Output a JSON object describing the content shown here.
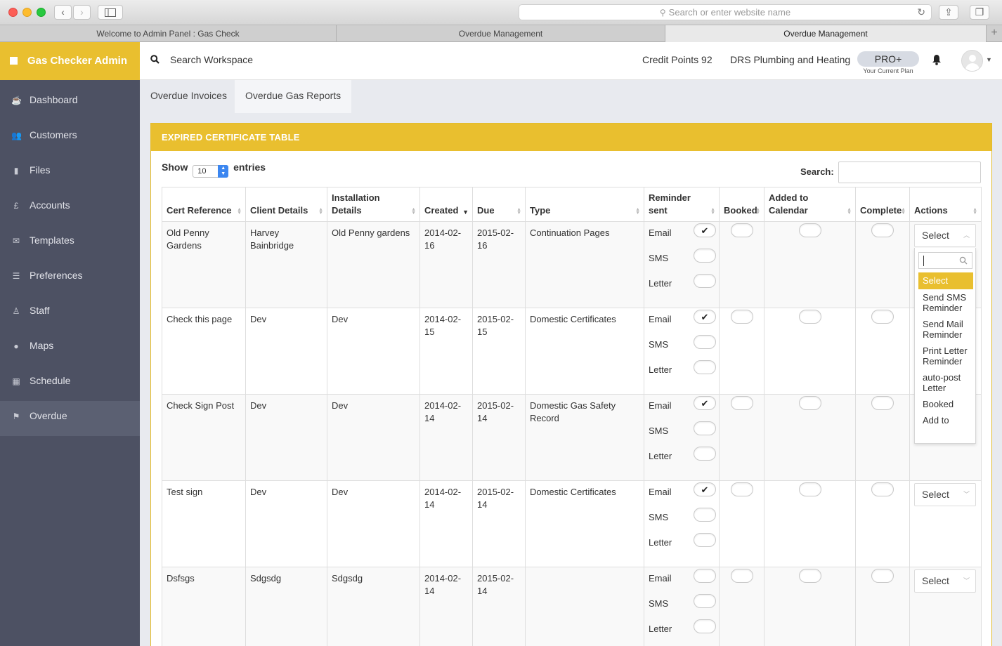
{
  "browser": {
    "address_placeholder": "Search or enter website name",
    "tabs": [
      "Welcome to Admin Panel : Gas Check",
      "Overdue Management",
      "Overdue Management"
    ]
  },
  "sidebar": {
    "brand": "Gas Checker Admin",
    "items": [
      {
        "label": "Dashboard",
        "icon": "dashboard-icon"
      },
      {
        "label": "Customers",
        "icon": "users-icon"
      },
      {
        "label": "Files",
        "icon": "file-icon"
      },
      {
        "label": "Accounts",
        "icon": "pound-icon"
      },
      {
        "label": "Templates",
        "icon": "envelope-icon"
      },
      {
        "label": "Preferences",
        "icon": "sliders-icon"
      },
      {
        "label": "Staff",
        "icon": "person-icon"
      },
      {
        "label": "Maps",
        "icon": "map-marker-icon"
      },
      {
        "label": "Schedule",
        "icon": "calendar-icon"
      },
      {
        "label": "Overdue",
        "icon": "flag-icon"
      }
    ],
    "active": "Overdue"
  },
  "header": {
    "search": "Search Workspace",
    "credit": "Credit Points 92",
    "company": "DRS Plumbing and Heating",
    "plan": "PRO+",
    "plan_sub": "Your Current Plan"
  },
  "page_tabs": [
    "Overdue Invoices",
    "Overdue Gas Reports"
  ],
  "panel": {
    "title": "EXPIRED CERTIFICATE TABLE",
    "show": "Show",
    "length": "10",
    "entries": "entries",
    "search_label": "Search:"
  },
  "table": {
    "columns": [
      "Cert Reference",
      "Client Details",
      "Installation Details",
      "Created",
      "Due",
      "Type",
      "Reminder sent",
      "Booked",
      "Added to Calendar",
      "Complete",
      "Actions"
    ],
    "reminder_labels": [
      "Email",
      "SMS",
      "Letter"
    ],
    "check": "✔",
    "rows": [
      {
        "cert": "Old Penny Gardens",
        "client": "Harvey Bainbridge",
        "install": "Old Penny gardens",
        "created": "2014-02-16",
        "due": "2015-02-16",
        "type": "Continuation Pages",
        "email": true,
        "action": "Select"
      },
      {
        "cert": "Check this page",
        "client": "Dev",
        "install": "Dev",
        "created": "2014-02-15",
        "due": "2015-02-15",
        "type": "Domestic Certificates",
        "email": true,
        "action": ""
      },
      {
        "cert": "Check Sign Post",
        "client": "Dev",
        "install": "Dev",
        "created": "2014-02-14",
        "due": "2015-02-14",
        "type": "Domestic Gas Safety Record",
        "email": true,
        "action": ""
      },
      {
        "cert": "Test sign",
        "client": "Dev",
        "install": "Dev",
        "created": "2014-02-14",
        "due": "2015-02-14",
        "type": "Domestic Certificates",
        "email": true,
        "action": "Select"
      },
      {
        "cert": "Dsfsgs",
        "client": "Sdgsdg",
        "install": "Sdgsdg",
        "created": "2014-02-14",
        "due": "2015-02-14",
        "type": "",
        "email": false,
        "action": "Select"
      }
    ]
  },
  "dropdown": {
    "options": [
      "Select",
      "Send SMS Reminder",
      "Send Mail Reminder",
      "Print Letter Reminder",
      "auto-post Letter",
      "Booked",
      "Add to"
    ]
  }
}
